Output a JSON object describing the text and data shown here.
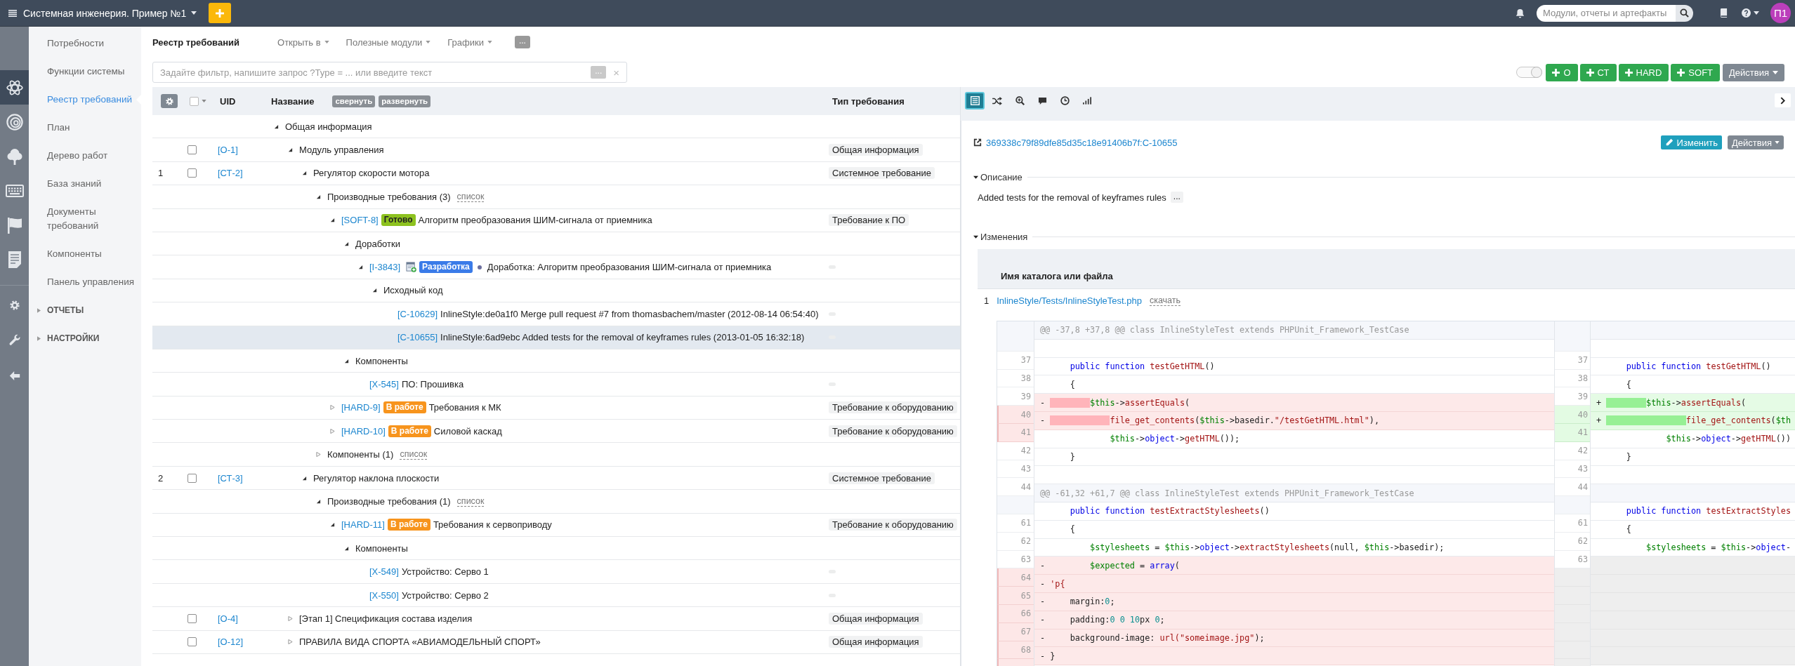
{
  "header": {
    "project": "Системная инженерия. Пример №1",
    "search": {
      "placeholder": "Модули, отчеты и артефакты"
    },
    "avatar": "П1"
  },
  "icon_bar": {
    "items": [
      {
        "kind": "atom",
        "selected": true
      },
      {
        "kind": "spiral",
        "selected": false
      },
      {
        "kind": "tree",
        "selected": false
      },
      {
        "kind": "keyboard",
        "selected": false
      },
      {
        "kind": "flag",
        "selected": false
      },
      {
        "kind": "document",
        "selected": false
      }
    ],
    "tools": [
      {
        "kind": "gear"
      },
      {
        "kind": "wrench"
      },
      {
        "kind": "back"
      }
    ]
  },
  "sidebar": {
    "items": [
      {
        "label": "Потребности",
        "selected": false
      },
      {
        "label": "Функции системы",
        "selected": false
      },
      {
        "label": "Реестр требований",
        "selected": true
      },
      {
        "label": "План",
        "selected": false
      },
      {
        "label": "Дерево работ",
        "selected": false
      },
      {
        "label": "База знаний",
        "selected": false
      },
      {
        "label": "Документы требований",
        "selected": false
      },
      {
        "label": "Компоненты",
        "selected": false
      },
      {
        "label": "Панель управления",
        "selected": false
      }
    ],
    "groups": [
      {
        "label": "ОТЧЕТЫ",
        "expanded": false
      },
      {
        "label": "НАСТРОЙКИ",
        "expanded": false
      }
    ]
  },
  "page": {
    "title": "Реестр требований",
    "menus": [
      "Открыть в",
      "Полезные модули",
      "Графики"
    ],
    "more": "...",
    "filter": {
      "placeholder": "Задайте фильтр, напишите запрос ?Type = ... или введите текст",
      "more": "...",
      "clear": "×"
    },
    "toggle": {
      "on": true
    },
    "create_buttons": [
      "О",
      "СТ",
      "HARD",
      "SOFT"
    ],
    "actions": "Действия"
  },
  "table": {
    "columns": {
      "uid": "UID",
      "name": "Название",
      "type": "Тип требования"
    },
    "select_all": {
      "checked": false
    },
    "collapse": "свернуть",
    "expand": "развернуть",
    "rows": [
      {
        "title": "Общая информация",
        "expanded": true,
        "selected": false,
        "children": [
          {
            "uid": "[О-1]",
            "checkbox": {
              "checked": false
            },
            "title": "Модуль управления",
            "type": "Общая информация",
            "expanded": true,
            "selected": false,
            "children": [
              {
                "number": "1",
                "uid": "[СТ-2]",
                "checkbox": {
                  "checked": false
                },
                "title": "Регулятор скорости мотора",
                "type": "Системное требование",
                "expanded": true,
                "selected": false,
                "children": [
                  {
                    "title": "Производные требования (3)",
                    "list_link": "список",
                    "expanded": true,
                    "selected": false,
                    "children": [
                      {
                        "ref": "[SOFT-8]",
                        "status": {
                          "label": "Готово",
                          "color": "#8dc21f"
                        },
                        "title": "Алгоритм преобразования ШИМ-сигнала от приемника",
                        "type": "Требование к ПО",
                        "expanded": true,
                        "selected": false,
                        "children": [
                          {
                            "title": "Доработки",
                            "expanded": true,
                            "selected": false,
                            "children": [
                              {
                                "ref": "[I-3843]",
                                "task_icon": true,
                                "status": {
                                  "label": "Разработка",
                                  "color": "#3a7be8"
                                },
                                "dot": {
                                  "color": "#6c6f9e"
                                },
                                "title": "Доработка: Алгоритм преобразования ШИМ-сигнала от приемника",
                                "type_blank": true,
                                "expanded": true,
                                "selected": false,
                                "children": [
                                  {
                                    "title": "Исходный код",
                                    "expanded": true,
                                    "selected": false,
                                    "children": [
                                      {
                                        "ref": "[C-10629]",
                                        "title": "InlineStyle:de0a1f0 Merge pull request #7 from thomasbachem/master (2012-08-14 06:54:40)",
                                        "type_blank": true,
                                        "selected": false
                                      },
                                      {
                                        "ref": "[C-10655]",
                                        "title": "InlineStyle:6ad9ebc Added tests for the removal of keyframes rules (2013-01-05 16:32:18)",
                                        "type_blank": true,
                                        "selected": true
                                      }
                                    ]
                                  }
                                ]
                              }
                            ]
                          },
                          {
                            "title": "Компоненты",
                            "expanded": true,
                            "selected": false,
                            "children": [
                              {
                                "ref": "[X-545]",
                                "title": "ПО: Прошивка",
                                "type_blank": true,
                                "selected": false
                              }
                            ]
                          }
                        ]
                      },
                      {
                        "ref": "[HARD-9]",
                        "status": {
                          "label": "В работе",
                          "color": "#f7941d"
                        },
                        "title": "Требования к МК",
                        "type": "Требование к оборудованию",
                        "expanded": false,
                        "selected": false
                      },
                      {
                        "ref": "[HARD-10]",
                        "status": {
                          "label": "В работе",
                          "color": "#f7941d"
                        },
                        "title": "Силовой каскад",
                        "type": "Требование к оборудованию",
                        "expanded": false,
                        "selected": false
                      }
                    ]
                  },
                  {
                    "title": "Компоненты (1)",
                    "list_link": "список",
                    "expanded": false,
                    "selected": false
                  }
                ]
              },
              {
                "number": "2",
                "uid": "[СТ-3]",
                "checkbox": {
                  "checked": false
                },
                "title": "Регулятор наклона плоскости",
                "type": "Системное требование",
                "expanded": true,
                "selected": false,
                "children": [
                  {
                    "title": "Производные требования (1)",
                    "list_link": "список",
                    "expanded": true,
                    "selected": false,
                    "children": [
                      {
                        "ref": "[HARD-11]",
                        "status": {
                          "label": "В работе",
                          "color": "#f7941d"
                        },
                        "title": "Требования к сервоприводу",
                        "type": "Требование к оборудованию",
                        "expanded": true,
                        "selected": false,
                        "children": [
                          {
                            "title": "Компоненты",
                            "expanded": true,
                            "selected": false,
                            "children": [
                              {
                                "ref": "[X-549]",
                                "title": "Устройство: Серво 1",
                                "type_blank": true,
                                "selected": false
                              },
                              {
                                "ref": "[X-550]",
                                "title": "Устройство: Серво 2",
                                "type_blank": true,
                                "selected": false
                              }
                            ]
                          }
                        ]
                      }
                    ]
                  }
                ]
              }
            ]
          },
          {
            "uid": "[О-4]",
            "checkbox": {
              "checked": false
            },
            "title": "[Этап 1] Спецификация состава изделия",
            "type": "Общая информация",
            "expanded": false,
            "selected": false
          },
          {
            "uid": "[О-12]",
            "checkbox": {
              "checked": false
            },
            "title": "ПРАВИЛА ВИДА СПОРТА «АВИАМОДЕЛЬНЫЙ СПОРТ»",
            "type": "Общая информация",
            "expanded": false,
            "selected": false
          }
        ]
      }
    ]
  },
  "detail": {
    "tabs": [
      {
        "kind": "list",
        "selected": true
      },
      {
        "kind": "shuffle",
        "selected": false
      },
      {
        "kind": "zoom",
        "selected": false
      },
      {
        "kind": "comment",
        "selected": false
      },
      {
        "kind": "history",
        "selected": false
      },
      {
        "kind": "bars",
        "selected": false
      }
    ],
    "link": "369338c79f89dfe85d35c18e91406b7f:C-10655",
    "edit_button": "Изменить",
    "actions": "Действия",
    "description": {
      "title": "Описание",
      "expanded": true,
      "text": "Added tests for the removal of keyframes rules",
      "more": "..."
    },
    "changes": {
      "title": "Изменения",
      "expanded": true,
      "column": "Имя каталога или файла",
      "files": [
        {
          "number": "1",
          "path": "InlineStyle/Tests/InlineStyleTest.php",
          "download": "скачать"
        }
      ],
      "diff": {
        "hunks": [
          {
            "old": {
              "header": "@@ -37,8 +37,8 @@ class InlineStyleTest extends PHPUnit_Framework_TestCase",
              "lines": [
                {
                  "num": "37",
                  "kind": "context"
                },
                {
                  "num": "38",
                  "kind": "context",
                  "code": [
                    {
                      "kind": "keyword",
                      "text": "    public function"
                    },
                    {
                      "kind": "function",
                      "text": " testGetHTML"
                    },
                    {
                      "kind": "plain",
                      "text": "()"
                    }
                  ]
                },
                {
                  "num": "39",
                  "kind": "context",
                  "code": [
                    {
                      "kind": "plain",
                      "text": "    {"
                    }
                  ]
                },
                {
                  "num": "40",
                  "kind": "removed",
                  "sign": "-",
                  "indent_changed": true,
                  "code": [
                    {
                      "kind": "variable",
                      "text": "        $this"
                    },
                    {
                      "kind": "plain",
                      "text": "->"
                    },
                    {
                      "kind": "function",
                      "text": "assertEquals"
                    },
                    {
                      "kind": "plain",
                      "text": "("
                    }
                  ]
                },
                {
                  "num": "41",
                  "kind": "removed",
                  "sign": "-",
                  "indent_changed": true,
                  "code": [
                    {
                      "kind": "function",
                      "text": "            file_get_contents"
                    },
                    {
                      "kind": "plain",
                      "text": "("
                    },
                    {
                      "kind": "variable",
                      "text": "$this"
                    },
                    {
                      "kind": "plain",
                      "text": "->basedir."
                    },
                    {
                      "kind": "string",
                      "text": "\"/testGetHTML.html\""
                    },
                    {
                      "kind": "plain",
                      "text": "),"
                    }
                  ]
                },
                {
                  "num": "42",
                  "kind": "context",
                  "code": [
                    {
                      "kind": "variable",
                      "text": "            $this"
                    },
                    {
                      "kind": "plain",
                      "text": "->"
                    },
                    {
                      "kind": "keyword",
                      "text": "object"
                    },
                    {
                      "kind": "plain",
                      "text": "->"
                    },
                    {
                      "kind": "function",
                      "text": "getHTML"
                    },
                    {
                      "kind": "plain",
                      "text": "());"
                    }
                  ]
                },
                {
                  "num": "43",
                  "kind": "context",
                  "code": [
                    {
                      "kind": "plain",
                      "text": "    }"
                    }
                  ]
                },
                {
                  "num": "44",
                  "kind": "context"
                }
              ]
            },
            "new": {
              "lines": [
                {
                  "num": "37",
                  "kind": "context"
                },
                {
                  "num": "38",
                  "kind": "context",
                  "code": [
                    {
                      "kind": "keyword",
                      "text": "    public function"
                    },
                    {
                      "kind": "function",
                      "text": " testGetHTML"
                    },
                    {
                      "kind": "plain",
                      "text": "()"
                    }
                  ]
                },
                {
                  "num": "39",
                  "kind": "context",
                  "code": [
                    {
                      "kind": "plain",
                      "text": "    {"
                    }
                  ]
                },
                {
                  "num": "40",
                  "kind": "added",
                  "sign": "+",
                  "indent_changed": true,
                  "code": [
                    {
                      "kind": "variable",
                      "text": "        $this"
                    },
                    {
                      "kind": "plain",
                      "text": "->"
                    },
                    {
                      "kind": "function",
                      "text": "assertEquals"
                    },
                    {
                      "kind": "plain",
                      "text": "("
                    }
                  ]
                },
                {
                  "num": "41",
                  "kind": "added",
                  "sign": "+",
                  "indent_changed": true,
                  "code": [
                    {
                      "kind": "function",
                      "text": "                file_get_contents"
                    },
                    {
                      "kind": "plain",
                      "text": "("
                    },
                    {
                      "kind": "variable",
                      "text": "$th"
                    }
                  ]
                },
                {
                  "num": "42",
                  "kind": "context",
                  "code": [
                    {
                      "kind": "variable",
                      "text": "            $this"
                    },
                    {
                      "kind": "plain",
                      "text": "->"
                    },
                    {
                      "kind": "keyword",
                      "text": "object"
                    },
                    {
                      "kind": "plain",
                      "text": "->"
                    },
                    {
                      "kind": "function",
                      "text": "getHTML"
                    },
                    {
                      "kind": "plain",
                      "text": "())"
                    }
                  ]
                },
                {
                  "num": "43",
                  "kind": "context",
                  "code": [
                    {
                      "kind": "plain",
                      "text": "    }"
                    }
                  ]
                },
                {
                  "num": "44",
                  "kind": "context"
                }
              ]
            }
          },
          {
            "old": {
              "header": "@@ -61,32 +61,7 @@ class InlineStyleTest extends PHPUnit_Framework_TestCase",
              "lines": [
                {
                  "num": "61",
                  "kind": "context",
                  "code": [
                    {
                      "kind": "keyword",
                      "text": "    public function"
                    },
                    {
                      "kind": "function",
                      "text": " testExtractStylesheets"
                    },
                    {
                      "kind": "plain",
                      "text": "()"
                    }
                  ]
                },
                {
                  "num": "62",
                  "kind": "context",
                  "code": [
                    {
                      "kind": "plain",
                      "text": "    {"
                    }
                  ]
                },
                {
                  "num": "63",
                  "kind": "context",
                  "code": [
                    {
                      "kind": "variable",
                      "text": "        $stylesheets"
                    },
                    {
                      "kind": "plain",
                      "text": " = "
                    },
                    {
                      "kind": "variable",
                      "text": "$this"
                    },
                    {
                      "kind": "plain",
                      "text": "->"
                    },
                    {
                      "kind": "keyword",
                      "text": "object"
                    },
                    {
                      "kind": "plain",
                      "text": "->"
                    },
                    {
                      "kind": "function",
                      "text": "extractStylesheets"
                    },
                    {
                      "kind": "plain",
                      "text": "(null, "
                    },
                    {
                      "kind": "variable",
                      "text": "$this"
                    },
                    {
                      "kind": "plain",
                      "text": "->basedir);"
                    }
                  ]
                },
                {
                  "num": "64",
                  "kind": "removed",
                  "sign": "-",
                  "code": [
                    {
                      "kind": "variable",
                      "text": "        $expected"
                    },
                    {
                      "kind": "plain",
                      "text": " = "
                    },
                    {
                      "kind": "keyword",
                      "text": "array"
                    },
                    {
                      "kind": "plain",
                      "text": "("
                    }
                  ]
                },
                {
                  "num": "65",
                  "kind": "removed",
                  "sign": "-",
                  "code": [
                    {
                      "kind": "string",
                      "text": "'p{"
                    }
                  ]
                },
                {
                  "num": "66",
                  "kind": "removed",
                  "sign": "-",
                  "code": [
                    {
                      "kind": "plain",
                      "text": "    margin:"
                    },
                    {
                      "kind": "number",
                      "text": "0"
                    },
                    {
                      "kind": "plain",
                      "text": ";"
                    }
                  ]
                },
                {
                  "num": "67",
                  "kind": "removed",
                  "sign": "-",
                  "code": [
                    {
                      "kind": "plain",
                      "text": "    padding:"
                    },
                    {
                      "kind": "number",
                      "text": "0 0 10"
                    },
                    {
                      "kind": "plain",
                      "text": "px "
                    },
                    {
                      "kind": "number",
                      "text": "0"
                    },
                    {
                      "kind": "plain",
                      "text": ";"
                    }
                  ]
                },
                {
                  "num": "68",
                  "kind": "removed",
                  "sign": "-",
                  "code": [
                    {
                      "kind": "plain",
                      "text": "    background-image: "
                    },
                    {
                      "kind": "string",
                      "text": "url(\"someimage.jpg\""
                    },
                    {
                      "kind": "plain",
                      "text": ");"
                    }
                  ]
                },
                {
                  "kind": "removed",
                  "sign": "-",
                  "code": [
                    {
                      "kind": "plain",
                      "text": "}"
                    }
                  ]
                }
              ]
            },
            "new": {
              "lines": [
                {
                  "num": "61",
                  "kind": "context",
                  "code": [
                    {
                      "kind": "keyword",
                      "text": "    public function"
                    },
                    {
                      "kind": "function",
                      "text": " testExtractStyles"
                    }
                  ]
                },
                {
                  "num": "62",
                  "kind": "context",
                  "code": [
                    {
                      "kind": "plain",
                      "text": "    {"
                    }
                  ]
                },
                {
                  "num": "63",
                  "kind": "context",
                  "code": [
                    {
                      "kind": "variable",
                      "text": "        $stylesheets"
                    },
                    {
                      "kind": "plain",
                      "text": " = "
                    },
                    {
                      "kind": "variable",
                      "text": "$this"
                    },
                    {
                      "kind": "plain",
                      "text": "->"
                    },
                    {
                      "kind": "keyword",
                      "text": "object"
                    },
                    {
                      "kind": "plain",
                      "text": "-"
                    }
                  ]
                },
                {
                  "kind": "empty"
                },
                {
                  "kind": "empty"
                },
                {
                  "kind": "empty"
                },
                {
                  "kind": "empty"
                },
                {
                  "kind": "empty"
                },
                {
                  "kind": "empty"
                }
              ]
            }
          }
        ]
      }
    }
  }
}
